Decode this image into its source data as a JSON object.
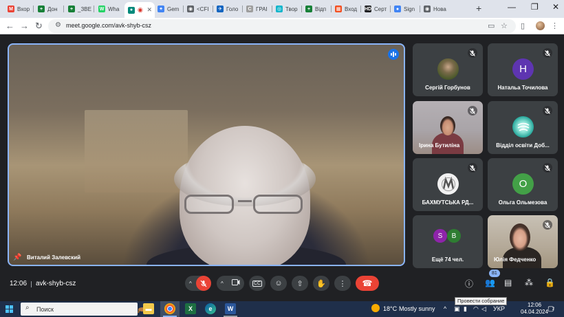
{
  "browser": {
    "tabs": [
      {
        "label": "Вхор",
        "fav_color": "#ea4335",
        "fav_glyph": "M"
      },
      {
        "label": "Дон",
        "fav_color": "#188038",
        "fav_glyph": "+"
      },
      {
        "label": "_ЗВЕ",
        "fav_color": "#188038",
        "fav_glyph": "+"
      },
      {
        "label": "Wha",
        "fav_color": "#25d366",
        "fav_glyph": "W"
      },
      {
        "label": "",
        "fav_color": "#00897b",
        "fav_glyph": "●"
      },
      {
        "label": "Gem",
        "fav_color": "#4285f4",
        "fav_glyph": "✦"
      },
      {
        "label": "<CFI",
        "fav_color": "#5f6368",
        "fav_glyph": "◉"
      },
      {
        "label": "Голо",
        "fav_color": "#1565c0",
        "fav_glyph": "✈"
      },
      {
        "label": "ГРАІ",
        "fav_color": "#9e9e9e",
        "fav_glyph": "C"
      },
      {
        "label": "Твор",
        "fav_color": "#12b5cb",
        "fav_glyph": "◎"
      },
      {
        "label": "Відп",
        "fav_color": "#188038",
        "fav_glyph": "+"
      },
      {
        "label": "Вход",
        "fav_color": "#f25022",
        "fav_glyph": "▦"
      },
      {
        "label": "Серт",
        "fav_color": "#202124",
        "fav_glyph": "HD"
      },
      {
        "label": "Sign",
        "fav_color": "#4285f4",
        "fav_glyph": "●"
      },
      {
        "label": "Нова",
        "fav_color": "#5f6368",
        "fav_glyph": "◉"
      }
    ],
    "url": "meet.google.com/avk-shyb-csz"
  },
  "meet": {
    "main_speaker": "Виталий Залевский",
    "participants": [
      {
        "name": "Сергій Горбунов",
        "avatar": "photo",
        "color": "#5b6b3a"
      },
      {
        "name": "Натальа Точилова",
        "avatar": "letter",
        "letter": "Н",
        "color": "#5e35b1"
      },
      {
        "name": "Ірина Бутиліна",
        "avatar": "video"
      },
      {
        "name": "Відділ освіти Доб...",
        "avatar": "logo",
        "color": "#26a69a"
      },
      {
        "name": "БАХМУТСЬКА РД...",
        "avatar": "logo",
        "color": "#e0e0e0"
      },
      {
        "name": "Ольга Ольмезова",
        "avatar": "letter",
        "letter": "О",
        "color": "#43a047"
      },
      {
        "name": "Ещё 74 чел.",
        "avatar": "group",
        "letters": [
          "S",
          "В"
        ]
      },
      {
        "name": "Юлія Федченко",
        "avatar": "video"
      }
    ],
    "time": "12:06",
    "meeting_code": "avk-shyb-csz",
    "people_count": "81",
    "tooltip": "Провести собрание"
  },
  "taskbar": {
    "search_placeholder": "Поиск",
    "weather_temp": "18°C",
    "weather_text": "Mostly sunny",
    "language": "УКР",
    "clock_time": "12:06",
    "clock_date": "04.04.2024",
    "notifications": "2"
  }
}
